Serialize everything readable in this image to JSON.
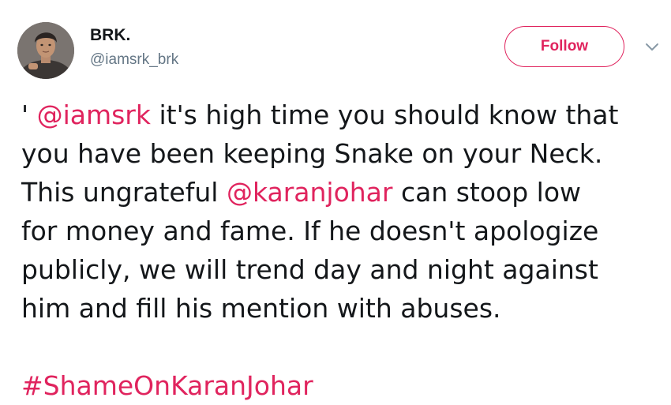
{
  "user": {
    "display_name": "BRK.",
    "handle": "@iamsrk_brk"
  },
  "follow_button": {
    "label": "Follow"
  },
  "icons": {
    "avatar": "profile-photo",
    "menu": "chevron-down-icon"
  },
  "colors": {
    "accent": "#e0245e",
    "secondary_text": "#657786",
    "text": "#14171a"
  },
  "tweet": {
    "line1_prefix": "' ",
    "line1_mention": "@iamsrk",
    "line1_text": " it's high time you should know that",
    "line2": "you have been keeping Snake on your Neck.",
    "line3_prefix": "This ungrateful ",
    "line3_mention": "@karanjohar",
    "line3_text": " can stoop low",
    "line4": "for money and fame. If he doesn't apologize",
    "line5": "publicly, we will trend day and night against",
    "line6": "him and fill his mention with abuses.",
    "hashtag": "#ShameOnKaranJohar"
  }
}
